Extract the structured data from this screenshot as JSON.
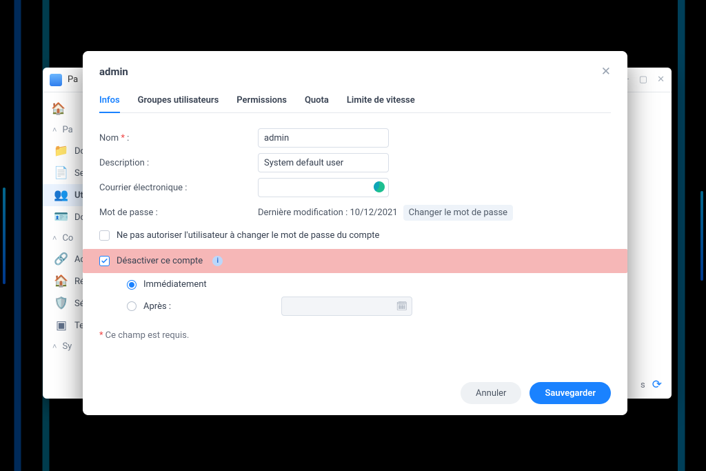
{
  "background_window": {
    "title_partial": "Pa",
    "sidebar": {
      "groups": [
        {
          "label_partial": "Pa"
        },
        {
          "label_partial": "Co"
        },
        {
          "label_partial": "Sy"
        }
      ],
      "items": [
        {
          "label_partial": "Do",
          "icon": "folder-icon"
        },
        {
          "label_partial": "Se",
          "icon": "file-icon"
        },
        {
          "label_partial": "Ut",
          "icon": "users-icon",
          "active": true
        },
        {
          "label_partial": "Do",
          "icon": "domain-icon"
        },
        {
          "label_partial": "Ac",
          "icon": "link-icon"
        },
        {
          "label_partial": "Ré",
          "icon": "network-icon"
        },
        {
          "label_partial": "Sé",
          "icon": "shield-icon"
        },
        {
          "label_partial": "Te",
          "icon": "terminal-icon"
        }
      ]
    },
    "footer_letter": "s"
  },
  "dialog": {
    "title": "admin",
    "tabs": [
      "Infos",
      "Groupes utilisateurs",
      "Permissions",
      "Quota",
      "Limite de vitesse"
    ],
    "active_tab": 0,
    "form": {
      "name_label": "Nom",
      "name_value": "admin",
      "desc_label": "Description :",
      "desc_value": "System default user",
      "email_label": "Courrier électronique :",
      "email_value": "",
      "password_label": "Mot de passe :",
      "password_lastmod": "Dernière modification : 10/12/2021",
      "password_change_link": "Changer le mot de passe",
      "checkbox_nopasschange": "Ne pas autoriser l'utilisateur à changer le mot de passe du compte",
      "checkbox_disable": "Désactiver ce compte",
      "radio_immediate": "Immédiatement",
      "radio_after": "Après :",
      "required_note": "Ce champ est requis."
    },
    "buttons": {
      "cancel": "Annuler",
      "save": "Sauvegarder"
    }
  }
}
